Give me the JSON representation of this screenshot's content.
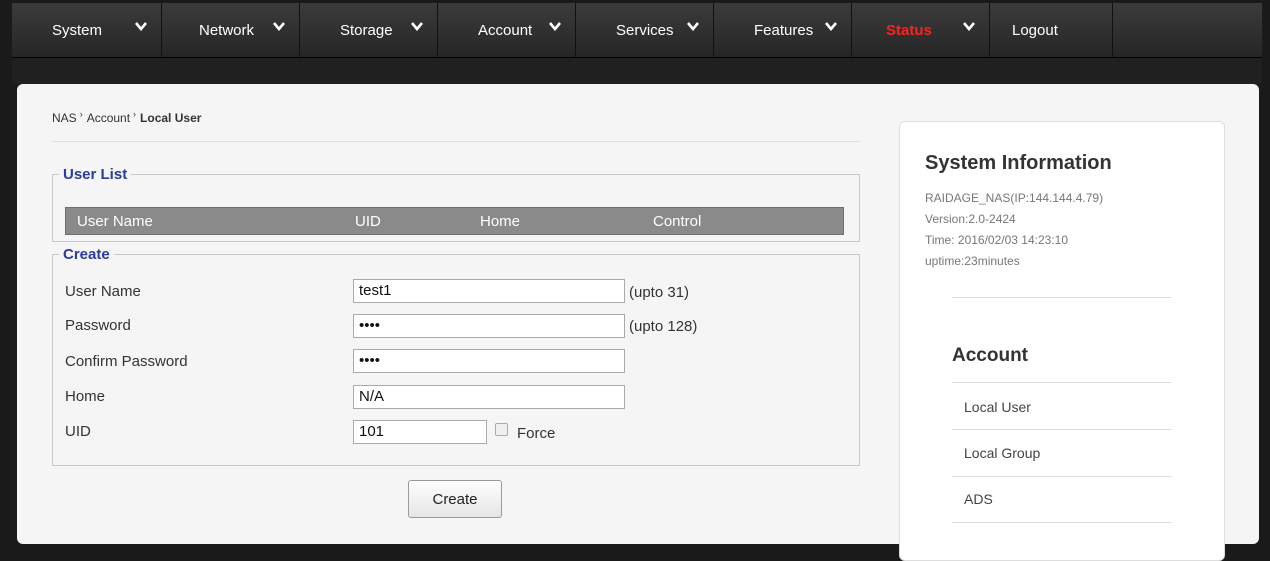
{
  "nav": {
    "items": [
      {
        "label": "System"
      },
      {
        "label": "Network"
      },
      {
        "label": "Storage"
      },
      {
        "label": "Account"
      },
      {
        "label": "Services"
      },
      {
        "label": "Features"
      },
      {
        "label": "Status"
      },
      {
        "label": "Logout"
      }
    ],
    "status_color": "#ff2020"
  },
  "breadcrumb": {
    "root": "NAS",
    "section": "Account",
    "current": "Local User"
  },
  "user_list": {
    "legend": "User List",
    "columns": [
      "User Name",
      "UID",
      "Home",
      "Control"
    ]
  },
  "create": {
    "legend": "Create",
    "fields": {
      "username": {
        "label": "User Name",
        "value": "test1",
        "hint": "(upto 31)"
      },
      "password": {
        "label": "Password",
        "value": "••••",
        "hint": "(upto 128)"
      },
      "confirm": {
        "label": "Confirm Password",
        "value": "••••"
      },
      "home": {
        "label": "Home",
        "value": "N/A"
      },
      "uid": {
        "label": "UID",
        "value": "101",
        "force_label": "Force",
        "force_checked": false
      }
    },
    "button": "Create"
  },
  "sidebar": {
    "title": "System Information",
    "host": "RAIDAGE_NAS(IP:144.144.4.79)",
    "version": "Version:2.0-2424",
    "time": "Time: 2016/02/03 14:23:10",
    "uptime": "uptime:23minutes",
    "account_title": "Account",
    "menu": [
      "Local User",
      "Local Group",
      "ADS"
    ]
  }
}
